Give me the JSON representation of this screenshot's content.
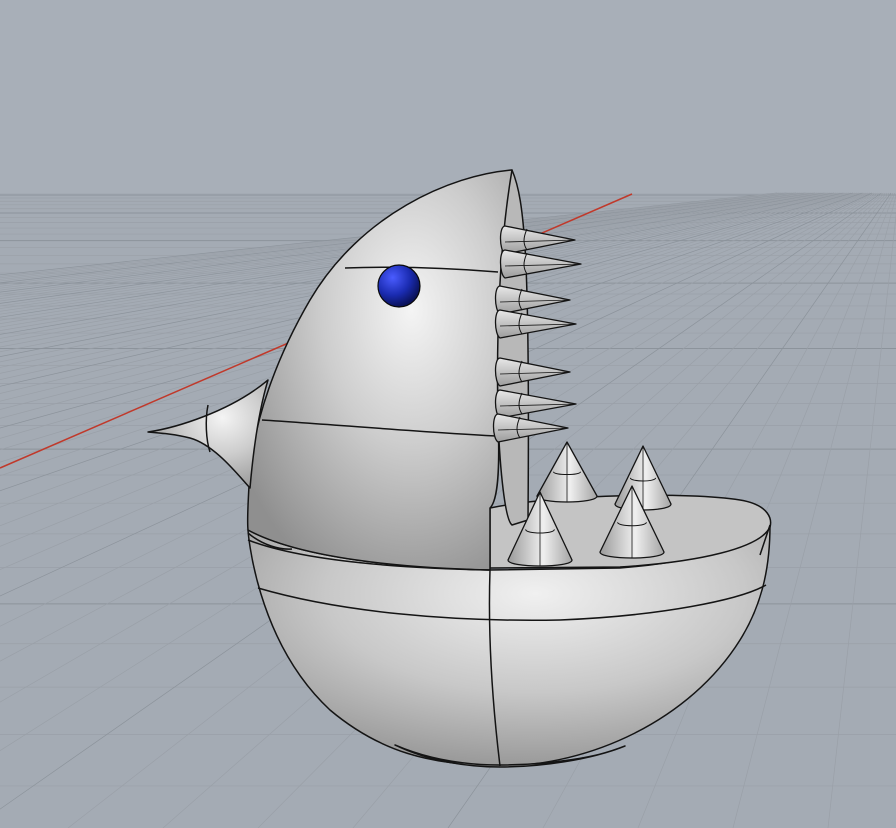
{
  "viewport": {
    "background_color": "#a8afb8",
    "grid_color": "#9aa0a8",
    "grid_major_color": "#8c939b",
    "x_axis_color": "#c0392b",
    "model_color": "#cfcfcf",
    "model_edge_color": "#141414",
    "eye_color": "#1a2bb0"
  },
  "model": {
    "description_icon": "shark-model-icon"
  }
}
